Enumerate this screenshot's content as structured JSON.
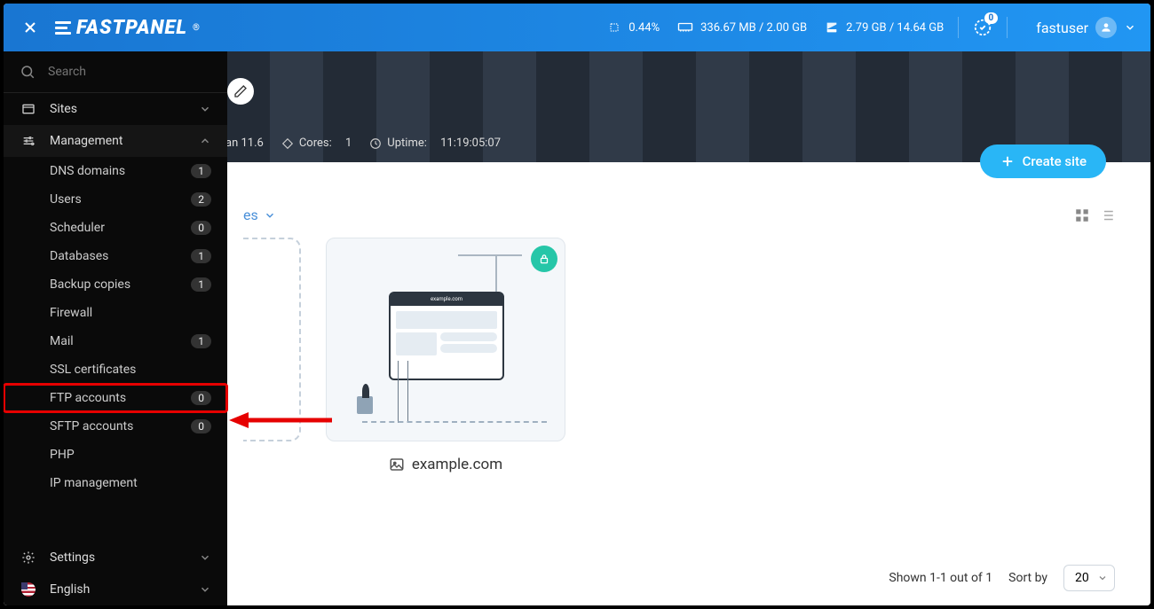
{
  "header": {
    "brand": "FASTPANEL",
    "cpu": "0.44%",
    "mem": "336.67 MB / 2.00 GB",
    "disk": "2.79 GB / 14.64 GB",
    "notif_count": "0",
    "user": "fastuser"
  },
  "sidebar": {
    "search_placeholder": "Search",
    "sites_label": "Sites",
    "management_label": "Management",
    "management_items": [
      {
        "label": "DNS domains",
        "count": "1"
      },
      {
        "label": "Users",
        "count": "2"
      },
      {
        "label": "Scheduler",
        "count": "0"
      },
      {
        "label": "Databases",
        "count": "1"
      },
      {
        "label": "Backup copies",
        "count": "1"
      },
      {
        "label": "Firewall",
        "count": null
      },
      {
        "label": "Mail",
        "count": "1"
      },
      {
        "label": "SSL certificates",
        "count": null
      },
      {
        "label": "FTP accounts",
        "count": "0"
      },
      {
        "label": "SFTP accounts",
        "count": "0"
      },
      {
        "label": "PHP",
        "count": null
      },
      {
        "label": "IP management",
        "count": null
      }
    ],
    "highlighted_index": 8,
    "settings_label": "Settings",
    "language_label": "English"
  },
  "hero": {
    "os_fragment": "an 11.6",
    "cores_label": "Cores:",
    "cores_value": "1",
    "uptime_label": "Uptime:",
    "uptime_value": "11:19:05:07"
  },
  "main": {
    "create_site": "Create site",
    "filter_fragment": "es",
    "site_domain": "example.com",
    "mock_url": "example.com",
    "shown_text": "Shown 1-1 out of 1",
    "sort_label": "Sort by",
    "sort_value": "20"
  }
}
